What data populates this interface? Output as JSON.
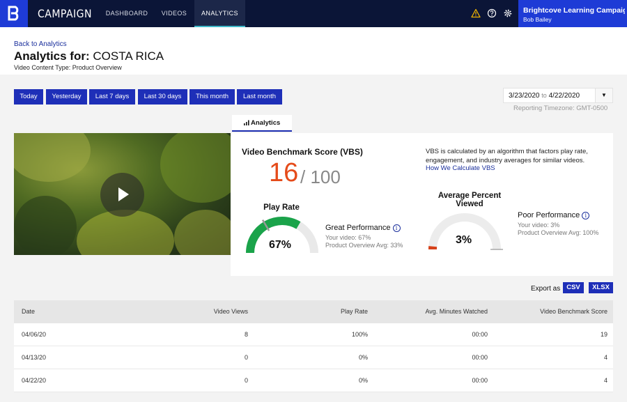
{
  "nav": {
    "brand": "CAMPAIGN",
    "items": [
      {
        "label": "DASHBOARD"
      },
      {
        "label": "VIDEOS"
      },
      {
        "label": "ANALYTICS"
      }
    ],
    "account_name": "Brightcove Learning Campaign",
    "user_name": "Bob Bailey",
    "icons": [
      "warning-icon",
      "help-icon",
      "gear-icon"
    ]
  },
  "header": {
    "back_link": "Back to Analytics",
    "title_prefix": "Analytics for:",
    "title_value": "COSTA RICA",
    "content_type": "Video Content Type: Product Overview"
  },
  "date_buttons": [
    "Today",
    "Yesterday",
    "Last 7 days",
    "Last 30 days",
    "This month",
    "Last month"
  ],
  "date_range": {
    "from": "3/23/2020",
    "to_label": "to",
    "to": "4/22/2020",
    "timezone": "Reporting Timezone: GMT-0500"
  },
  "tab": {
    "label": "Analytics"
  },
  "vbs": {
    "title": "Video Benchmark Score (VBS)",
    "score": "16",
    "max": "/ 100",
    "description": "VBS is calculated by an algorithm that factors play rate, engagement, and industry averages for similar videos.",
    "link": "How We Calculate VBS"
  },
  "play_rate": {
    "title": "Play Rate",
    "value": "67%",
    "fill": 0.67,
    "benchmark": 0.33,
    "performance": "Great Performance",
    "your_video": "Your video: 67%",
    "avg": "Product Overview Avg: 33%",
    "color": "#1aa34a"
  },
  "avg_viewed": {
    "title": "Average Percent Viewed",
    "value": "3%",
    "fill": 0.03,
    "benchmark": 1.0,
    "performance": "Poor Performance",
    "your_video": "Your video: 3%",
    "avg": "Product Overview Avg: 100%",
    "color": "#d6411a"
  },
  "export": {
    "label": "Export as",
    "csv": "CSV",
    "xlsx": "XLSX"
  },
  "table": {
    "headers": [
      "Date",
      "Video Views",
      "Play Rate",
      "Avg. Minutes Watched",
      "Video Benchmark Score"
    ],
    "rows": [
      [
        "04/06/20",
        "8",
        "100%",
        "00:00",
        "19"
      ],
      [
        "04/13/20",
        "0",
        "0%",
        "00:00",
        "4"
      ],
      [
        "04/22/20",
        "0",
        "0%",
        "00:00",
        "4"
      ]
    ]
  }
}
